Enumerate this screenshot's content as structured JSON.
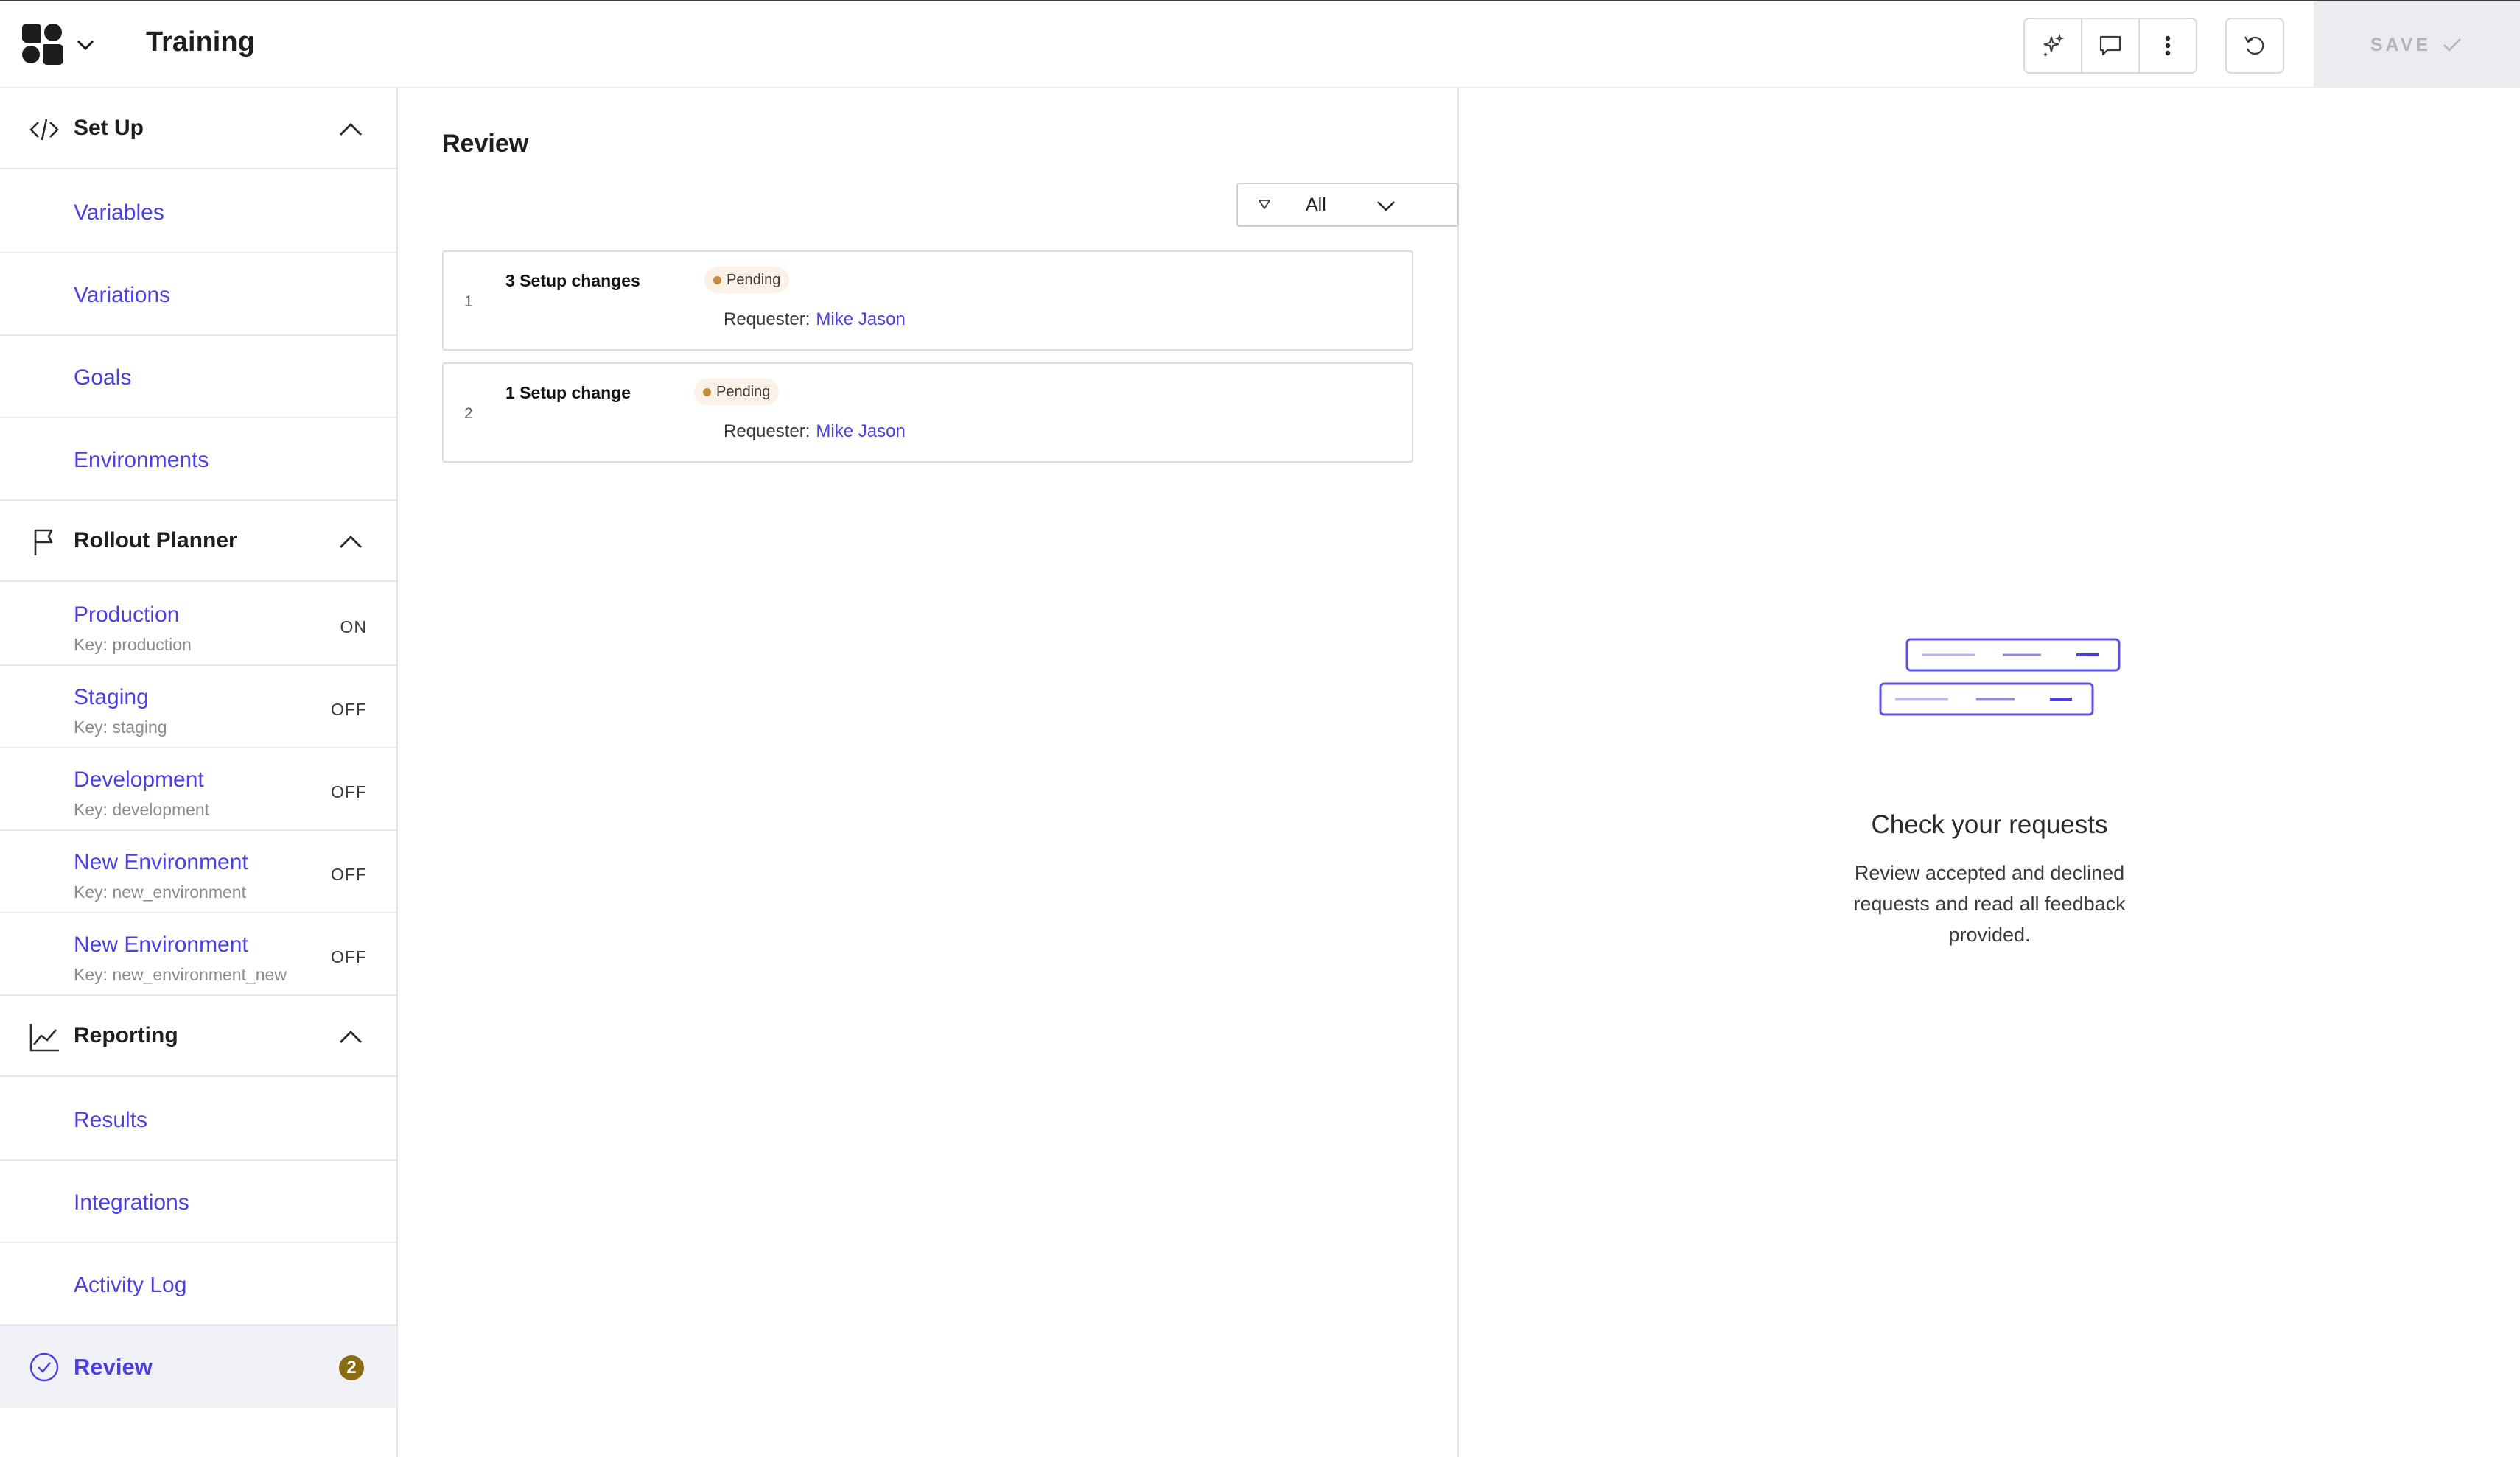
{
  "header": {
    "title": "Training",
    "save_label": "SAVE"
  },
  "sidebar": {
    "setup": {
      "label": "Set Up",
      "items": [
        {
          "label": "Variables"
        },
        {
          "label": "Variations"
        },
        {
          "label": "Goals"
        },
        {
          "label": "Environments"
        }
      ]
    },
    "rollout": {
      "label": "Rollout Planner",
      "environments": [
        {
          "label": "Production",
          "key": "Key: production",
          "status": "ON"
        },
        {
          "label": "Staging",
          "key": "Key: staging",
          "status": "OFF"
        },
        {
          "label": "Development",
          "key": "Key: development",
          "status": "OFF"
        },
        {
          "label": "New Environment",
          "key": "Key: new_environment",
          "status": "OFF"
        },
        {
          "label": "New Environment",
          "key": "Key: new_environment_new",
          "status": "OFF"
        }
      ]
    },
    "reporting": {
      "label": "Reporting",
      "items": [
        {
          "label": "Results"
        },
        {
          "label": "Integrations"
        },
        {
          "label": "Activity Log"
        }
      ]
    },
    "review": {
      "label": "Review",
      "badge": "2"
    }
  },
  "main": {
    "title": "Review",
    "filter_value": "All",
    "requests": [
      {
        "num": "1",
        "title": "3 Setup changes",
        "status": "Pending",
        "requester_label": "Requester:",
        "requester": "Mike Jason"
      },
      {
        "num": "2",
        "title": "1 Setup change",
        "status": "Pending",
        "requester_label": "Requester:",
        "requester": "Mike Jason"
      }
    ]
  },
  "detail": {
    "empty_title": "Check your requests",
    "empty_desc": "Review accepted and declined requests and read all feedback provided."
  },
  "colors": {
    "accent": "#4a3fe0",
    "pending": "#c58a3a",
    "badge": "#8a6b12"
  }
}
